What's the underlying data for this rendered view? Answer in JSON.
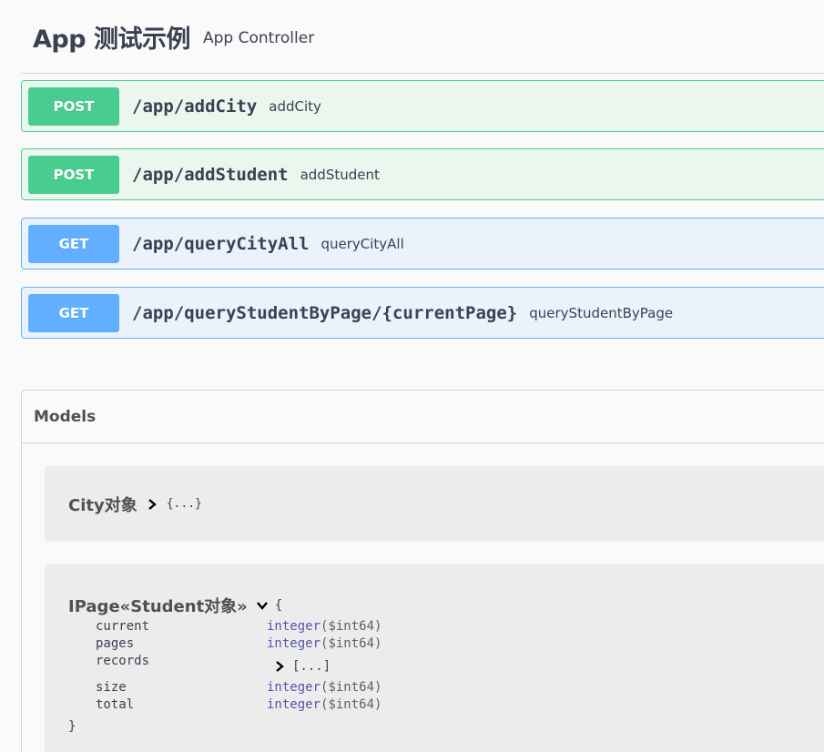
{
  "tag": {
    "name": "App 测试示例",
    "description": "App Controller"
  },
  "operations": [
    {
      "method": "POST",
      "path": "/app/addCity",
      "summary": "addCity"
    },
    {
      "method": "POST",
      "path": "/app/addStudent",
      "summary": "addStudent"
    },
    {
      "method": "GET",
      "path": "/app/queryCityAll",
      "summary": "queryCityAll"
    },
    {
      "method": "GET",
      "path": "/app/queryStudentByPage/{currentPage}",
      "summary": "queryStudentByPage"
    }
  ],
  "models": {
    "title": "Models",
    "city": {
      "name": "City对象",
      "collapsed": "{...}"
    },
    "ipage": {
      "name": "IPage«Student对象»",
      "open_brace": "{",
      "close_brace": "}",
      "properties": [
        {
          "name": "current",
          "type": "integer",
          "format": "($int64)"
        },
        {
          "name": "pages",
          "type": "integer",
          "format": "($int64)"
        },
        {
          "name": "records",
          "collapsed": "[...]"
        },
        {
          "name": "size",
          "type": "integer",
          "format": "($int64)"
        },
        {
          "name": "total",
          "type": "integer",
          "format": "($int64)"
        }
      ]
    }
  },
  "colors": {
    "post": "#49cc90",
    "get": "#61afe",
    "text": "#3b4151"
  }
}
